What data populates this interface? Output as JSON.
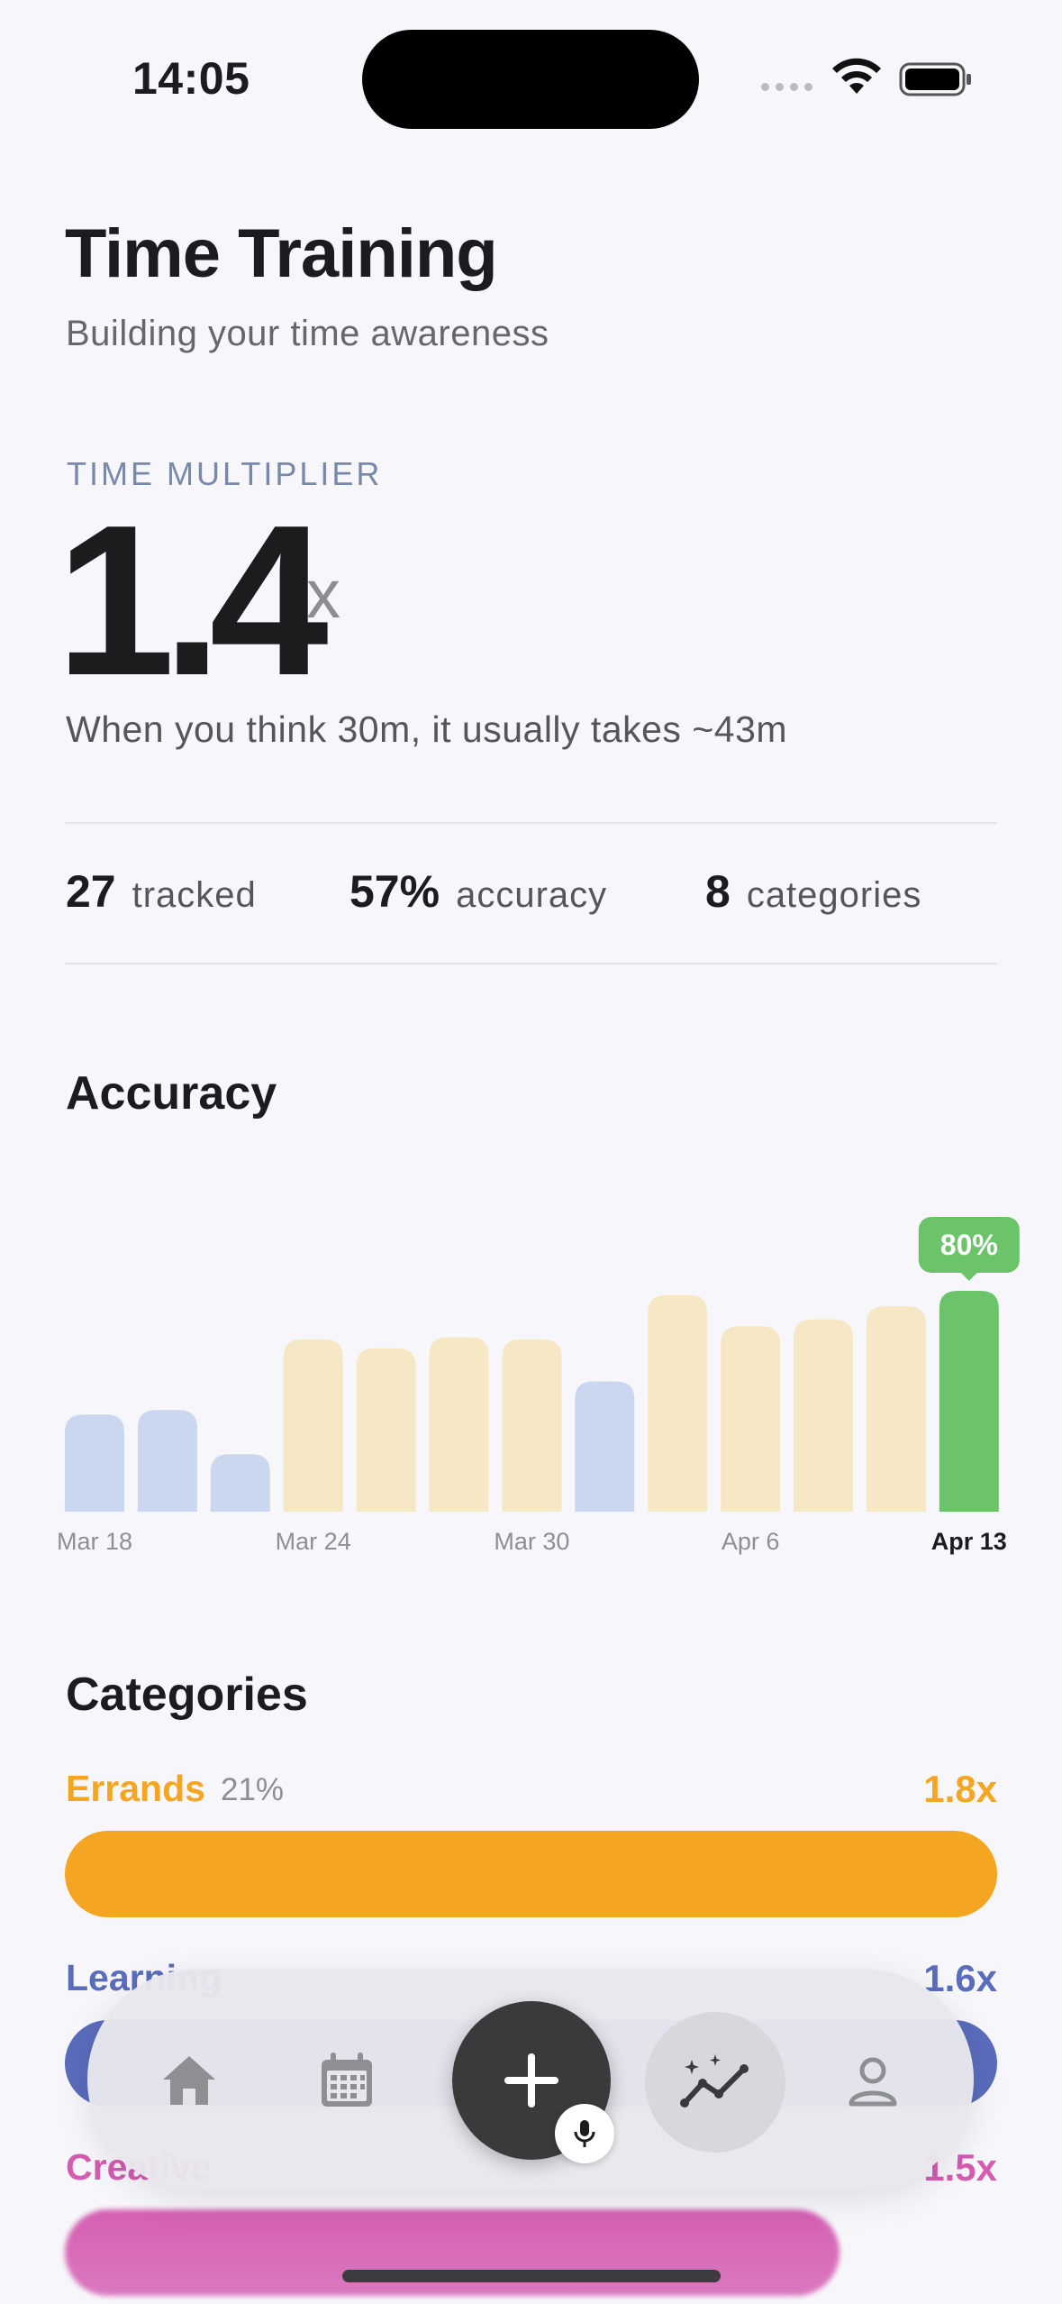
{
  "status_bar": {
    "time": "14:05"
  },
  "header": {
    "title": "Time Training",
    "subtitle": "Building your time awareness"
  },
  "multiplier": {
    "label": "TIME MULTIPLIER",
    "value": "1.4",
    "unit": "x",
    "description": "When you think 30m, it usually takes ~43m"
  },
  "stats": [
    {
      "value": "27",
      "label": "tracked"
    },
    {
      "value": "57%",
      "label": "accuracy"
    },
    {
      "value": "8",
      "label": "categories"
    }
  ],
  "accuracy_section": {
    "title": "Accuracy"
  },
  "chart_data": {
    "type": "bar",
    "title": "Accuracy",
    "x_tick_labels": [
      "Mar 18",
      "Mar 24",
      "Mar 30",
      "Apr 6",
      "Apr 13"
    ],
    "values": [
      44,
      46,
      26,
      78,
      74,
      79,
      78,
      59,
      98,
      84,
      87,
      93,
      100
    ],
    "bar_colors": [
      "#cad7ee",
      "#cad7ee",
      "#cad7ee",
      "#f6e8c5",
      "#f6e8c5",
      "#f6e8c5",
      "#f6e8c5",
      "#cad7ee",
      "#f6e8c5",
      "#f6e8c5",
      "#f6e8c5",
      "#f6e8c5",
      "#6cc46a"
    ],
    "highlight_index": 12,
    "highlight_label": "80%",
    "highlight_color": "#6cc46a",
    "grid": false
  },
  "categories_section": {
    "title": "Categories",
    "items": [
      {
        "name": "Errands",
        "percent": "21%",
        "multiplier": "1.8x",
        "color": "#f4a623",
        "fill": 1.0
      },
      {
        "name": "Learning",
        "percent": "",
        "multiplier": "1.6x",
        "color": "#5a6cbc",
        "fill": 0.9
      },
      {
        "name": "Creative",
        "percent": "",
        "multiplier": "1.5x",
        "color": "#d45cb1",
        "fill": 0.85
      }
    ]
  },
  "nav": {
    "items": [
      {
        "icon": "home-icon",
        "active": false
      },
      {
        "icon": "calendar-icon",
        "active": false
      },
      {
        "icon": "plus-icon",
        "active": false
      },
      {
        "icon": "insights-icon",
        "active": true
      },
      {
        "icon": "profile-icon",
        "active": false
      }
    ],
    "mic_icon": "mic-icon"
  }
}
